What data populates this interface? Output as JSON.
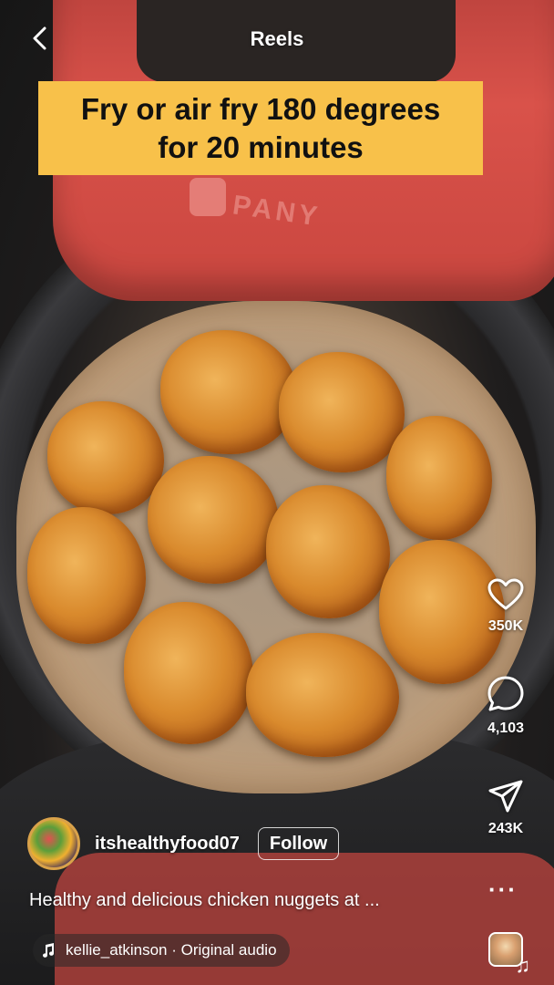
{
  "header": {
    "title": "Reels"
  },
  "video": {
    "caption": "Fry or air fry  180 degrees\nfor 20 minutes",
    "caption_color": "#f8c14a",
    "brand_text": "PANY"
  },
  "actions": {
    "likes": "350K",
    "comments": "4,103",
    "shares": "243K"
  },
  "post": {
    "username": "itshealthyfood07",
    "follow_label": "Follow",
    "description": "Healthy and delicious chicken nuggets at ...",
    "audio_author": "kellie_atkinson",
    "audio_separator": " · ",
    "audio_title": "Original audio"
  },
  "icons": [
    "back-icon",
    "heart-icon",
    "comment-icon",
    "share-icon",
    "more-icon",
    "music-note-icon"
  ]
}
